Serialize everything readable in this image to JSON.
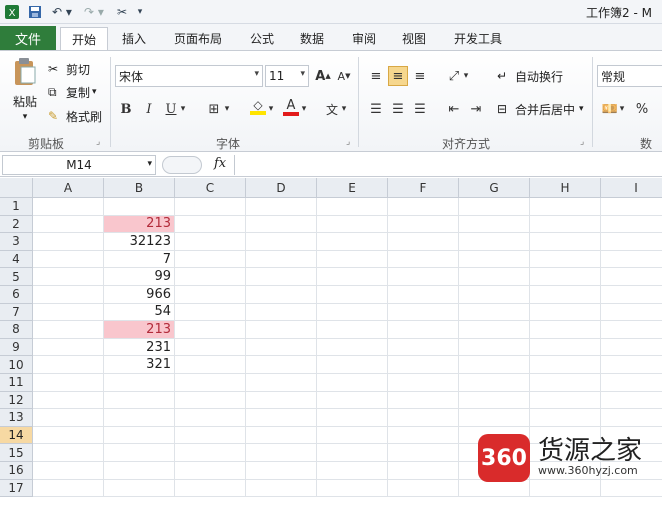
{
  "title": "工作簿2 - M",
  "tabs": [
    {
      "label": "文件"
    },
    {
      "label": "开始"
    },
    {
      "label": "插入"
    },
    {
      "label": "页面布局"
    },
    {
      "label": "公式"
    },
    {
      "label": "数据"
    },
    {
      "label": "审阅"
    },
    {
      "label": "视图"
    },
    {
      "label": "开发工具"
    }
  ],
  "ribbon": {
    "clipboard": {
      "paste": "粘贴",
      "cut": "剪切",
      "copy": "复制",
      "painter": "格式刷",
      "label": "剪贴板"
    },
    "font": {
      "name": "宋体",
      "size": "11",
      "bold": "B",
      "italic": "I",
      "underline": "U",
      "label": "字体"
    },
    "align": {
      "wrap": "自动换行",
      "merge": "合并后居中",
      "label": "对齐方式"
    },
    "number": {
      "format": "常规",
      "percent": "%",
      "label": "数字"
    }
  },
  "formula_bar": {
    "name_box": "M14",
    "fx": "fx"
  },
  "columns": [
    "A",
    "B",
    "C",
    "D",
    "E",
    "F",
    "G",
    "H",
    "I"
  ],
  "rows": [
    "1",
    "2",
    "3",
    "4",
    "5",
    "6",
    "7",
    "8",
    "9",
    "10",
    "11",
    "12",
    "13",
    "14",
    "15",
    "16",
    "17"
  ],
  "selected_row": "14",
  "colB_values": [
    "",
    "213",
    "32123",
    "7",
    "99",
    "966",
    "54",
    "213",
    "231",
    "321",
    "",
    "",
    "",
    "",
    "",
    "",
    ""
  ],
  "highlight_color": "#f9c6cd",
  "watermark": {
    "badge": "360",
    "title": "货源之家",
    "url": "www.360hyzj.com"
  }
}
